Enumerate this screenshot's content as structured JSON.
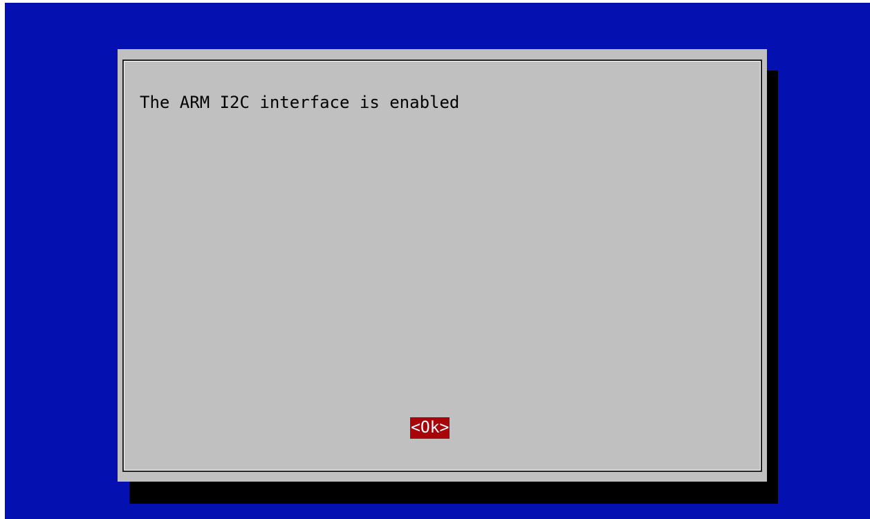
{
  "dialog": {
    "message": "The ARM I2C interface is enabled",
    "ok_label": "<Ok>"
  },
  "colors": {
    "background": "#0411b0",
    "dialog": "#c0c0c0",
    "shadow": "#000000",
    "button_highlight": "#a8050b",
    "button_text": "#ffffff"
  }
}
